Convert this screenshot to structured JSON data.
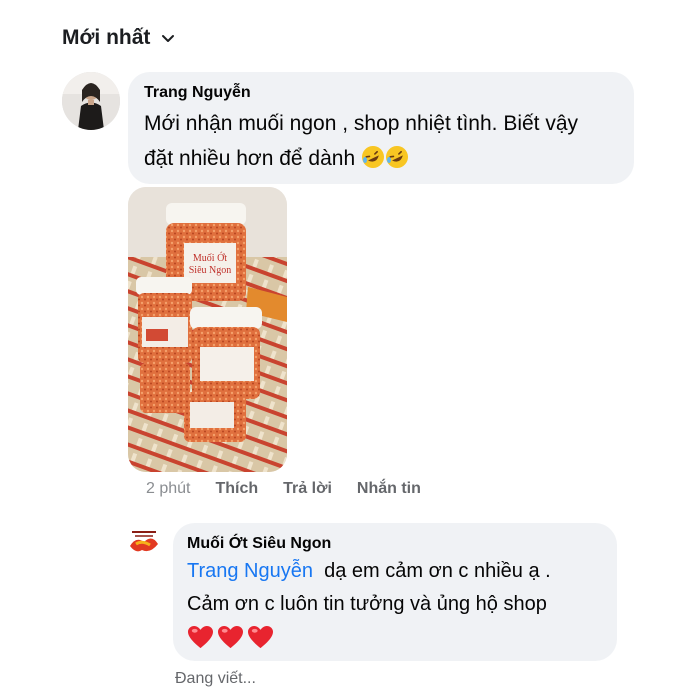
{
  "sort": {
    "label": "Mới nhất"
  },
  "comment": {
    "author": "Trang Nguyễn",
    "text_line1": "Mới nhận muối ngon , shop nhiệt tình. Biết vậy",
    "text_line2": "đặt nhiều hơn để dành",
    "time": "2 phút",
    "like_label": "Thích",
    "reply_label": "Trả lời",
    "message_label": "Nhắn tin",
    "photo_label_line1": "Muối Ớt",
    "photo_label_line2": "Siêu Ngon"
  },
  "reply": {
    "author": "Muối Ớt Siêu Ngon",
    "mention": "Trang Nguyễn",
    "text_line1_after_mention": "dạ em cảm ơn c nhiều ạ .",
    "text_line2": "Cảm ơn c luôn tin tưởng và ủng hộ shop",
    "heart_count": 3
  },
  "typing": {
    "text": "Đang viết..."
  },
  "colors": {
    "bubble": "#f0f2f5",
    "mention": "#1877f2",
    "secondary_text": "#65676b",
    "heart": "#e8242f"
  }
}
